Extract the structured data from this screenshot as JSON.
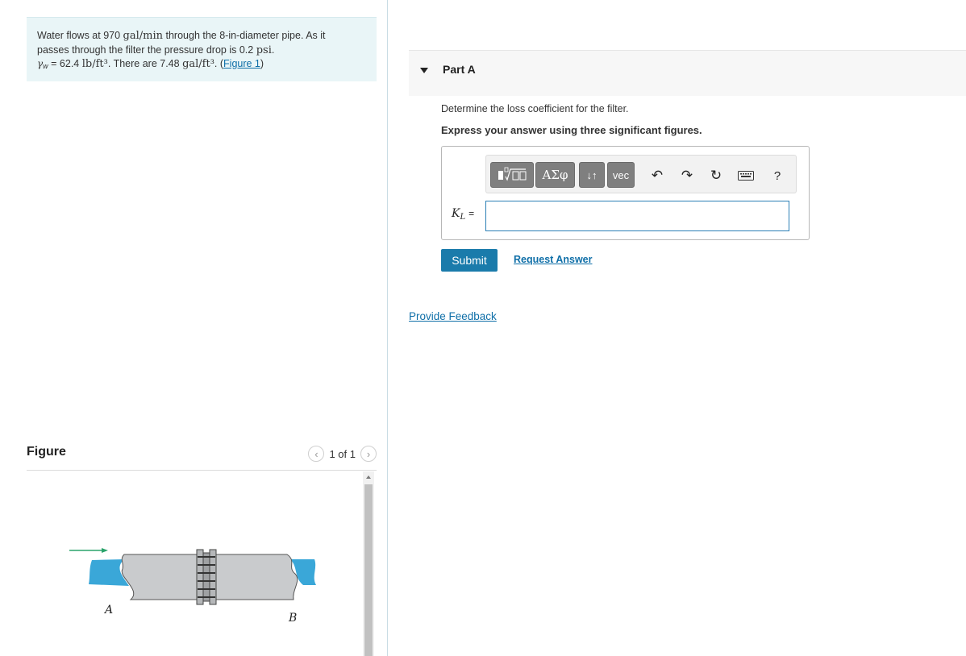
{
  "problem": {
    "line1_pre": "Water flows at 970",
    "flow_unit": "gal/min",
    "line1_post": "through the 8-in-diameter pipe. As it",
    "line2_pre": "passes through the filter the pressure drop is 0.2",
    "pressure_unit": "psi",
    "line2_post": ".",
    "gamma_symbol": "γ",
    "gamma_sub": "w",
    "gamma_value": "= 62.4",
    "gamma_unit": "lb/ft³",
    "line3_mid": ". There are 7.48",
    "conv_unit": "gal/ft³",
    "line3_post": ". (",
    "figure_link": "Figure 1",
    "line3_end": ")"
  },
  "figure": {
    "title": "Figure",
    "pager_text": "1 of 1",
    "prev_icon": "‹",
    "next_icon": "›",
    "label_a": "A",
    "label_b": "B",
    "colors": {
      "water": "#3aa7d8",
      "pipe": "#c9cbcd",
      "arrow": "#2aa36b"
    }
  },
  "part": {
    "title": "Part A",
    "question": "Determine the loss coefficient for the filter.",
    "instruction": "Express your answer using three significant figures.",
    "toolbar": {
      "greek_label": "ΑΣφ",
      "arrows_label": "↓↑",
      "vec_label": "vec",
      "undo_icon": "↶",
      "redo_icon": "↷",
      "reset_icon": "↻",
      "help_label": "?"
    },
    "answer_symbol": "K",
    "answer_sub": "L",
    "answer_eq": "=",
    "answer_value": "",
    "submit_label": "Submit",
    "request_label": "Request Answer"
  },
  "feedback_label": "Provide Feedback",
  "colors": {
    "accent": "#1a7bab",
    "link": "#0f6fa8",
    "problem_bg": "#e9f5f7"
  }
}
